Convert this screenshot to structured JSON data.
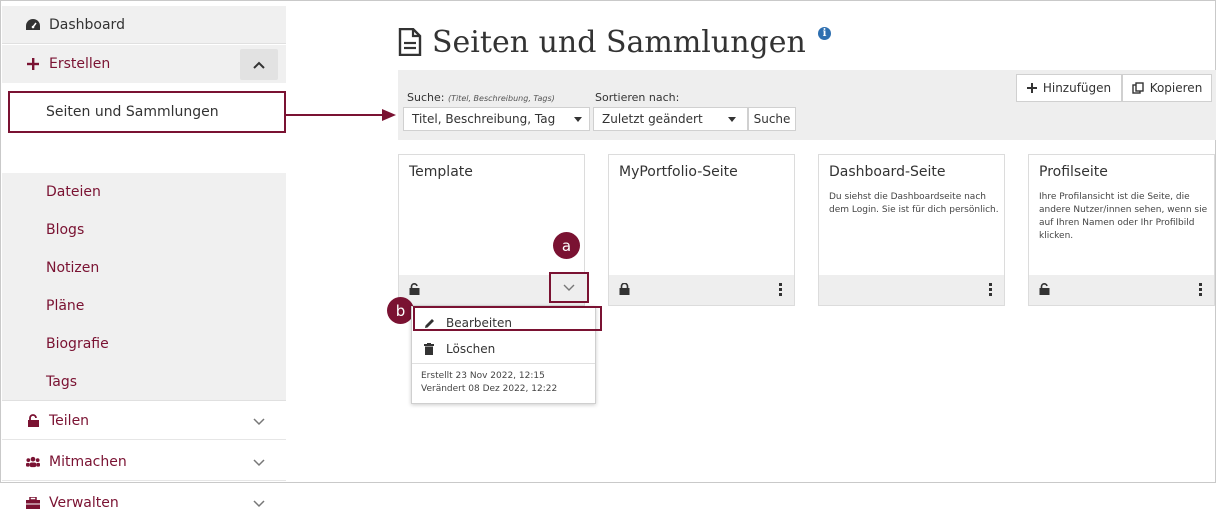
{
  "sidebar": {
    "items": [
      {
        "label": "Dashboard",
        "icon": "dashboard-icon"
      },
      {
        "label": "Erstellen",
        "icon": "plus-icon"
      },
      {
        "label": "Seiten und Sammlungen"
      },
      {
        "label": "Dateien"
      },
      {
        "label": "Blogs"
      },
      {
        "label": "Notizen"
      },
      {
        "label": "Pläne"
      },
      {
        "label": "Biografie"
      },
      {
        "label": "Tags"
      },
      {
        "label": "Teilen",
        "icon": "unlock-icon"
      },
      {
        "label": "Mitmachen",
        "icon": "users-icon"
      },
      {
        "label": "Verwalten",
        "icon": "briefcase-icon"
      }
    ]
  },
  "header": {
    "title": "Seiten und Sammlungen",
    "info_icon": "info-icon"
  },
  "toolbar": {
    "search_label": "Suche:",
    "search_hint": "(Titel, Beschreibung, Tags)",
    "sort_label": "Sortieren nach:",
    "search_scope_value": "Titel, Beschreibung, Tag",
    "sort_value": "Zuletzt geändert",
    "search_button": "Suche",
    "add_button": "Hinzufügen",
    "copy_button": "Kopieren"
  },
  "cards": [
    {
      "title": "Template",
      "description": ""
    },
    {
      "title": "MyPortfolio-Seite",
      "description": ""
    },
    {
      "title": "Dashboard-Seite",
      "description": "Du siehst die Dashboardseite nach dem Login. Sie ist für dich persönlich."
    },
    {
      "title": "Profilseite",
      "description": "Ihre Profilansicht ist die Seite, die andere Nutzer/innen sehen, wenn sie auf Ihren Namen oder Ihr Profilbild klicken."
    }
  ],
  "dropdown": {
    "edit_label": "Bearbeiten",
    "delete_label": "Löschen",
    "created": "Erstellt 23 Nov 2022, 12:15",
    "modified": "Verändert 08 Dez 2022, 12:22"
  },
  "callouts": {
    "a": "a",
    "b": "b"
  },
  "colors": {
    "accent": "#7a1232",
    "info": "#2e6fb0",
    "toolbar_bg": "#eeeeee",
    "sidebar_bg": "#f0f0f0"
  }
}
